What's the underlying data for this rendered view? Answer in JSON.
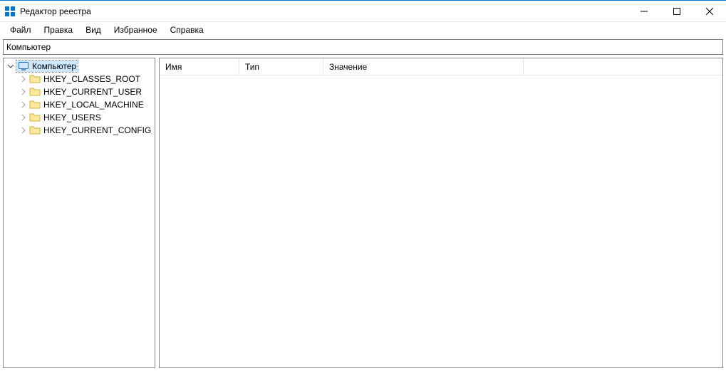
{
  "window": {
    "title": "Редактор реестра"
  },
  "menu": {
    "file": "Файл",
    "edit": "Правка",
    "view": "Вид",
    "favorites": "Избранное",
    "help": "Справка"
  },
  "address": {
    "path": "Компьютер"
  },
  "tree": {
    "root": "Компьютер",
    "items": [
      {
        "label": "HKEY_CLASSES_ROOT"
      },
      {
        "label": "HKEY_CURRENT_USER"
      },
      {
        "label": "HKEY_LOCAL_MACHINE"
      },
      {
        "label": "HKEY_USERS"
      },
      {
        "label": "HKEY_CURRENT_CONFIG"
      }
    ]
  },
  "list": {
    "columns": {
      "name": "Имя",
      "type": "Тип",
      "value": "Значение"
    }
  }
}
